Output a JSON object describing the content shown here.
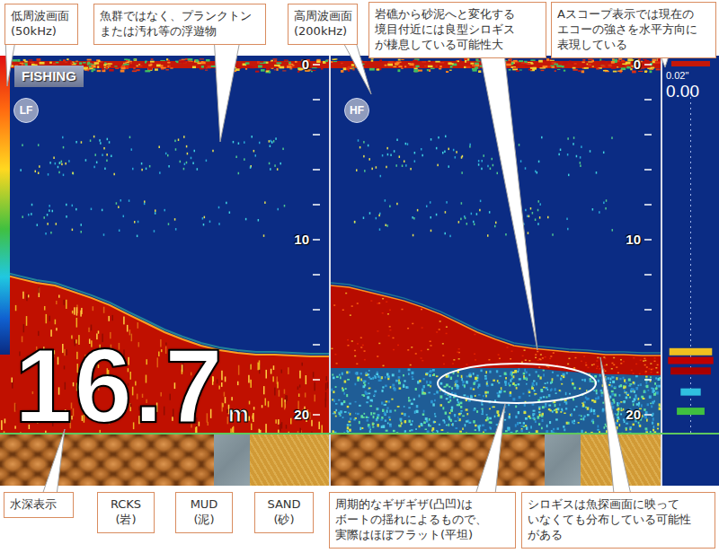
{
  "screen": {
    "mode": "FISHING",
    "depth": {
      "value": "16.7",
      "unit": "m"
    },
    "panels": [
      {
        "kind": "lf",
        "badge": "LF",
        "scale": [
          "0",
          "10",
          "20"
        ],
        "bottom_profile": [
          11.95,
          12.21,
          12.46,
          12.62,
          12.97,
          13.33,
          13.74,
          14.26,
          14.77,
          15.28,
          15.69,
          16.05,
          16.31,
          16.46,
          16.56,
          16.56,
          16.62,
          16.67,
          16.67
        ],
        "strip": [
          {
            "kind": "rocks"
          },
          {
            "kind": "mud"
          },
          {
            "kind": "sand"
          }
        ]
      },
      {
        "kind": "hf",
        "badge": "HF",
        "scale": [
          "0",
          "10",
          "20"
        ],
        "bottom_profile": [
          12.62,
          12.72,
          12.97,
          13.23,
          13.49,
          13.85,
          14.26,
          14.77,
          15.28,
          15.69,
          16.05,
          16.21,
          16.31,
          16.41,
          16.46,
          16.56,
          16.56,
          16.62,
          16.62
        ],
        "strip": [
          {
            "kind": "rocks"
          },
          {
            "kind": "mud"
          },
          {
            "kind": "sand"
          }
        ]
      }
    ],
    "ascope": {
      "range": "0.02\"",
      "value": "0.00",
      "echoes": [
        {
          "depth": 16.4,
          "level": 0.85,
          "color": "#f0c020"
        },
        {
          "depth": 16.9,
          "level": 0.9,
          "color": "#c00000"
        },
        {
          "depth": 17.5,
          "level": 0.8,
          "color": "#a80000"
        },
        {
          "depth": 18.7,
          "level": 0.4,
          "color": "#30c0e0"
        },
        {
          "depth": 19.8,
          "level": 0.55,
          "color": "#40c040"
        }
      ]
    }
  },
  "callouts_top": [
    {
      "lines": [
        "低周波画面",
        "(50kHz)"
      ]
    },
    {
      "lines": [
        "魚群ではなく、プランクトン",
        "または汚れ等の浮遊物"
      ]
    },
    {
      "lines": [
        "高周波画面",
        "(200kHz)"
      ]
    },
    {
      "lines": [
        "岩礁から砂泥へと変化する",
        "境目付近には良型シロギス",
        "が棲息している可能性大"
      ]
    },
    {
      "lines": [
        "Aスコープ表示では現在の",
        "エコーの強さを水平方向に",
        "表現している"
      ]
    }
  ],
  "callouts_bottom": [
    {
      "lines": [
        "水深表示"
      ]
    },
    {
      "lines": [
        "RCKS",
        "(岩)"
      ]
    },
    {
      "lines": [
        "MUD",
        "(泥)"
      ]
    },
    {
      "lines": [
        "SAND",
        "(砂)"
      ]
    },
    {
      "lines": [
        "周期的なギザギザ(凸凹)は",
        "ボートの揺れによるもので、",
        "実際はほぼフラット(平坦)"
      ]
    },
    {
      "lines": [
        "シロギスは魚探画面に映って",
        "いなくても分布している可能性",
        "がある"
      ]
    }
  ]
}
